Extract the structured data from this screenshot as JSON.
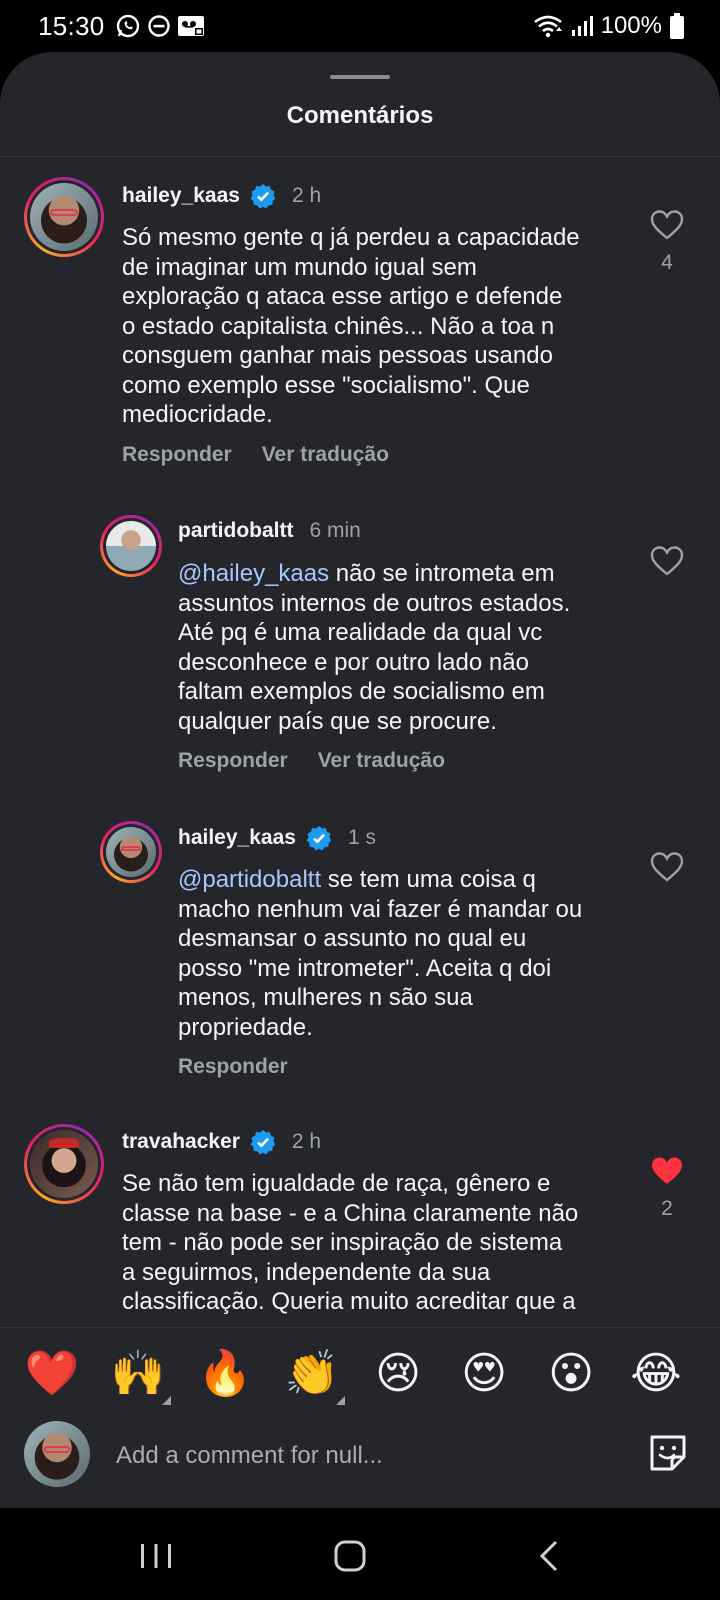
{
  "status_bar": {
    "time": "15:30",
    "left_icons": [
      "whatsapp-icon",
      "do-not-disturb-icon",
      "voicemail-icon"
    ],
    "right_icons": [
      "wifi-icon",
      "signal-icon",
      "battery-icon"
    ],
    "battery": "100%"
  },
  "sheet": {
    "title": "Comentários"
  },
  "comments": [
    {
      "username": "hailey_kaas",
      "verified": true,
      "time": "2 h",
      "text": "Só mesmo gente q já perdeu a capacidade de imaginar um mundo igual sem exploração q ataca esse artigo e defende o estado capitalista chinês... Não a toa n consguem ganhar mais pessoas usando como exemplo esse \"socialismo\". Que mediocridade.",
      "text_lines": [
        "Só mesmo gente q já perdeu a capacidade",
        "de imaginar um mundo igual sem",
        "exploração q ataca esse artigo e defende",
        "o estado capitalista chinês... Não a toa n",
        "consguem ganhar mais pessoas usando",
        "como exemplo esse \"socialismo\". Que",
        "mediocridade."
      ],
      "reply_label": "Responder",
      "translate_label": "Ver tradução",
      "like_count": "4",
      "liked": false
    },
    {
      "username": "partidobaltt",
      "verified": false,
      "time": "6 min",
      "mention": "@hailey_kaas",
      "text": "não se intrometa em assuntos internos de outros estados. Até pq é uma realidade da qual vc desconhece e por outro lado não faltam exemplos de socialismo em qualquer país que se procure.",
      "text_lines": [
        " não se intrometa em",
        "assuntos internos de outros estados.",
        "Até pq é uma realidade da qual vc",
        "desconhece e por outro lado não",
        "faltam exemplos de socialismo em",
        "qualquer país que se procure."
      ],
      "reply_label": "Responder",
      "translate_label": "Ver tradução",
      "liked": false
    },
    {
      "username": "hailey_kaas",
      "verified": true,
      "time": "1 s",
      "mention": "@partidobaltt",
      "text": "se tem uma coisa q macho nenhum vai fazer é mandar ou desmansar o assunto no qual eu posso \"me intrometer\". Aceita q doi menos, mulheres n são sua propriedade.",
      "text_lines": [
        " se tem uma coisa q",
        "macho nenhum vai fazer é mandar ou",
        "desmansar o assunto no qual eu",
        "posso \"me intrometer\". Aceita q doi",
        "menos, mulheres n são sua",
        "propriedade."
      ],
      "reply_label": "Responder",
      "liked": false
    },
    {
      "username": "travahacker",
      "verified": true,
      "time": "2 h",
      "text": "Se não tem igualdade de raça, gênero e classe na base - e a China claramente não tem - não pode ser inspiração de sistema a seguirmos, independente da sua classificação. Queria muito acreditar que a",
      "text_lines": [
        "Se não tem igualdade de raça, gênero e",
        "classe na base - e a China claramente não",
        "tem - não pode ser inspiração de sistema",
        "a seguirmos, independente da sua",
        "classificação. Queria muito acreditar que a"
      ],
      "like_count": "2",
      "liked": true
    }
  ],
  "emoji_bar": {
    "emojis": [
      "❤️",
      "🙌",
      "🔥",
      "👏",
      "😢",
      "😍",
      "😮",
      "😂"
    ]
  },
  "composer": {
    "placeholder": "Add a comment for null..."
  },
  "nav_bar": {
    "buttons": [
      "recent-apps",
      "home",
      "back"
    ]
  },
  "colors": {
    "sheet_bg": "#24262b",
    "text": "#f5f5f5",
    "muted": "#9ea2a8",
    "mention": "#a7c7ff",
    "verified": "#1d9bf0",
    "liked": "#ff3040"
  }
}
